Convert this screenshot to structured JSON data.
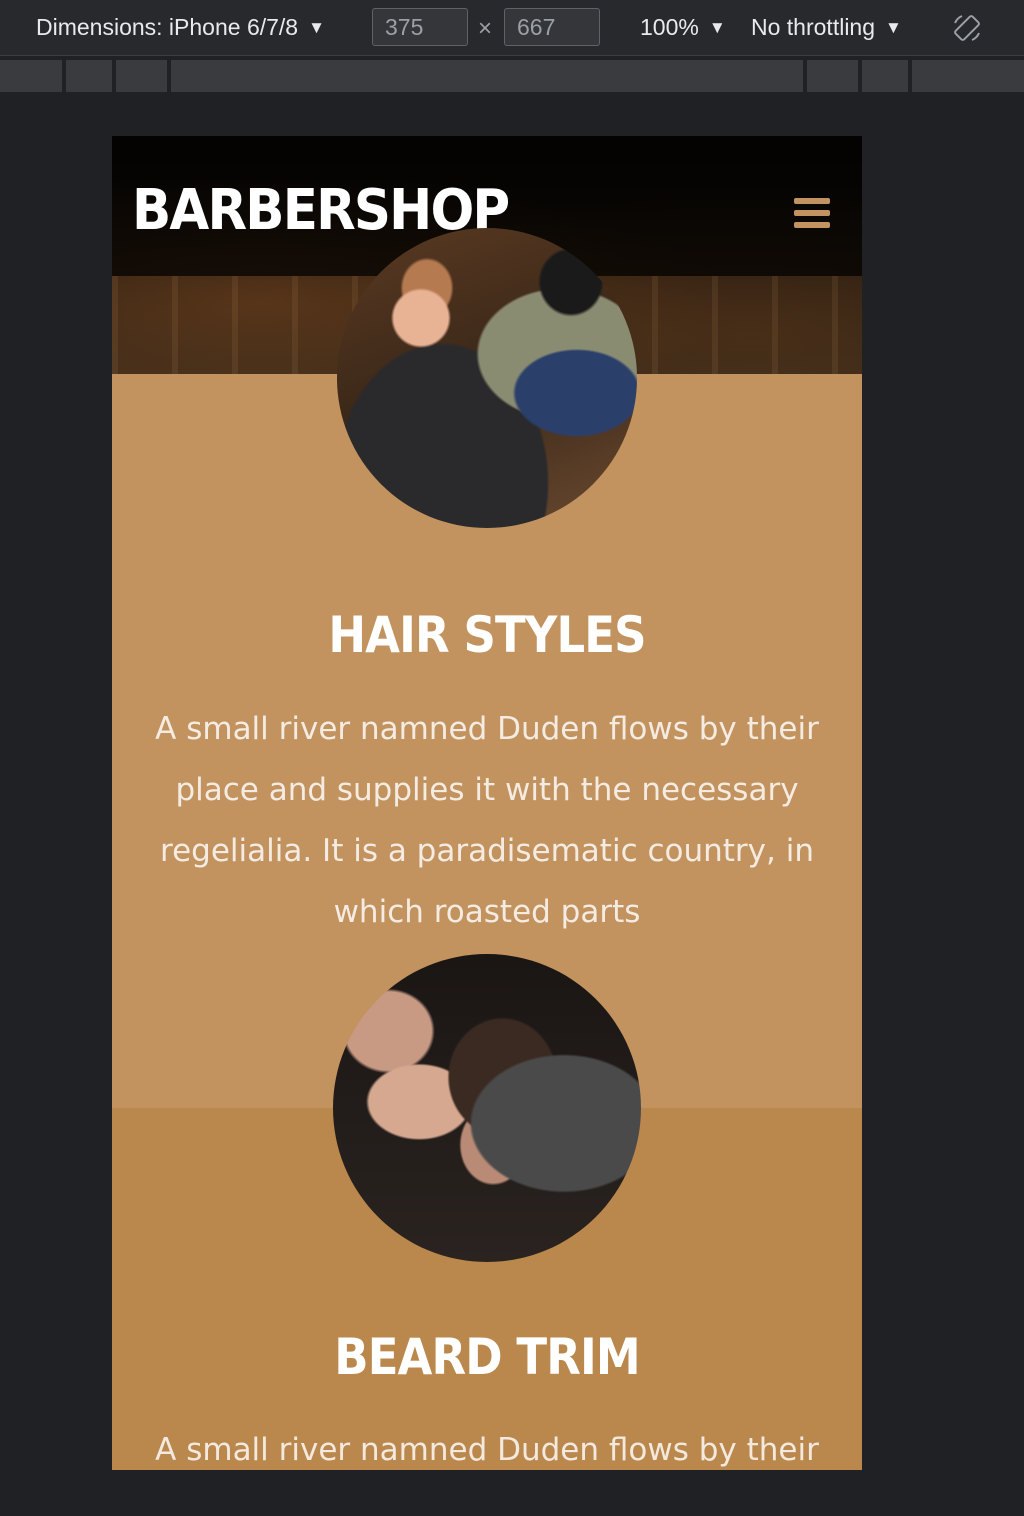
{
  "devtools": {
    "dimensions_label": "Dimensions: iPhone 6/7/8",
    "width_value": "375",
    "height_value": "667",
    "times_symbol": "×",
    "zoom_label": "100%",
    "throttling_label": "No throttling",
    "caret": "▼",
    "rotate_icon": "rotate-icon"
  },
  "site": {
    "brand": "BARBERSHOP",
    "menu_icon": "hamburger-menu-icon",
    "accent_color": "#c29360",
    "sections": [
      {
        "image": "haircut-photo",
        "title": "HAIR STYLES",
        "text": "A small river namned Duden flows by their place and supplies it with the necessary regelialia. It is a paradisematic country, in which roasted parts"
      },
      {
        "image": "beard-trim-photo",
        "title": "BEARD TRIM",
        "text": "A small river namned Duden flows by their"
      }
    ]
  }
}
